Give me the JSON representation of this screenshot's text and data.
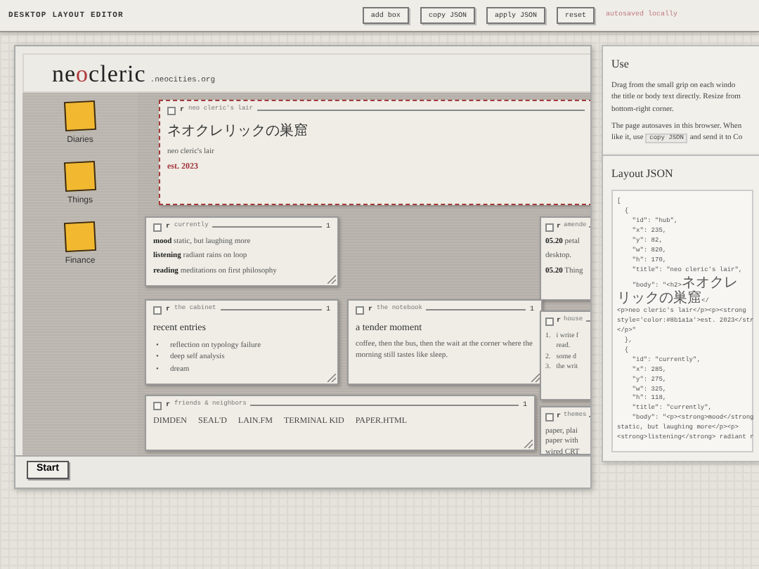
{
  "toolbar": {
    "title": "DESKTOP LAYOUT EDITOR",
    "buttons": [
      "add box",
      "copy JSON",
      "apply JSON",
      "reset"
    ],
    "status": "autosaved locally"
  },
  "site_header": {
    "logo_parts": [
      {
        "text": "ne",
        "accent": false
      },
      {
        "text": "o",
        "accent": true
      },
      {
        "text": "cleric",
        "accent": false
      }
    ],
    "domain": ".neocities.org"
  },
  "desktop_icons": [
    {
      "label": "Diaries"
    },
    {
      "label": "Things"
    },
    {
      "label": "Finance"
    }
  ],
  "windows": [
    {
      "title": "neo cleric's lair",
      "grip": "r",
      "selected": true,
      "checked": false,
      "blocks": [
        {
          "kind": "heading",
          "text": "ネオクレリックの巣窟"
        },
        {
          "kind": "plain",
          "text": "neo cleric's lair"
        },
        {
          "kind": "accent",
          "text": "est. 2023"
        }
      ]
    },
    {
      "title": "currently",
      "grip": "r",
      "end_mark": "1",
      "selected": false,
      "checked": false,
      "blocks": [
        {
          "kind": "field",
          "label": "mood",
          "text": "static, but laughing more"
        },
        {
          "kind": "field",
          "label": "listening",
          "text": "radiant rains on loop"
        },
        {
          "kind": "field",
          "label": "reading",
          "text": "meditations on first philosophy"
        }
      ]
    },
    {
      "title": "amende",
      "grip": "r",
      "selected": false,
      "checked": false,
      "blocks": [
        {
          "kind": "field",
          "label": "05.20",
          "text": "petal"
        },
        {
          "kind": "plain",
          "text": "desktop."
        },
        {
          "kind": "field",
          "label": "05.20",
          "text": "Thing"
        }
      ]
    },
    {
      "title": "the cabinet",
      "grip": "r",
      "end_mark": "1",
      "selected": false,
      "checked": false,
      "blocks": [
        {
          "kind": "heading",
          "text": "recent entries"
        },
        {
          "kind": "bullets",
          "items": [
            {
              "marker": "•",
              "text": "reflection on typology failure"
            },
            {
              "marker": "•",
              "text": "deep self analysis"
            },
            {
              "marker": "•",
              "text": "dream"
            }
          ]
        }
      ]
    },
    {
      "title": "the notebook",
      "grip": "r",
      "end_mark": "1",
      "selected": false,
      "checked": false,
      "blocks": [
        {
          "kind": "heading",
          "text": "a tender moment"
        },
        {
          "kind": "plain",
          "text": "coffee, then the bus, then the wait at the corner where the morning still tastes like sleep."
        }
      ]
    },
    {
      "title": "house",
      "grip": "r",
      "selected": false,
      "checked": false,
      "blocks": [
        {
          "kind": "ordered",
          "items": [
            {
              "marker": "1.",
              "lines": [
                "i write f",
                "read."
              ]
            },
            {
              "marker": "2.",
              "lines": [
                "some d"
              ]
            },
            {
              "marker": "3.",
              "lines": [
                "the writ"
              ]
            }
          ]
        }
      ]
    },
    {
      "title": "friends & neighbors",
      "grip": "r",
      "end_mark": "1",
      "selected": false,
      "checked": false,
      "blocks": [
        {
          "kind": "links",
          "items": [
            "DIMDEN",
            "SEAL'D",
            "LAIN.FM",
            "TERMINAL KID",
            "PAPER.HTML"
          ]
        }
      ]
    },
    {
      "title": "themes",
      "grip": "r",
      "selected": false,
      "checked": false,
      "blocks": [
        {
          "kind": "lines",
          "items": [
            "paper, plai",
            "paper with",
            "wired CRT"
          ]
        }
      ]
    }
  ],
  "taskbar": {
    "start": "Start"
  },
  "use_panel": {
    "title": "Use",
    "paragraphs": [
      [
        [
          {
            "kind": "text",
            "text": "Drag from the small grip on each windo"
          }
        ],
        [
          {
            "kind": "text",
            "text": "the title or body text directly. Resize from"
          }
        ],
        [
          {
            "kind": "text",
            "text": "bottom-right corner."
          }
        ]
      ],
      [
        [
          {
            "kind": "text",
            "text": "The page autosaves in this browser. When"
          }
        ],
        [
          {
            "kind": "text",
            "text": "like it, use "
          },
          {
            "kind": "code",
            "text": "copy JSON"
          },
          {
            "kind": "text",
            "text": " and send it to Co"
          }
        ]
      ]
    ]
  },
  "json_panel": {
    "title": "Layout JSON",
    "lines": [
      "[",
      "  {",
      "    \"id\": \"hub\",",
      "    \"x\": 235,",
      "    \"y\": 82,",
      "    \"w\": 820,",
      "    \"h\": 170,",
      "    \"title\": \"neo cleric's lair\",",
      "    \"body\": \"<h2>ネオクレリックの巣窟</",
      "<p>neo cleric's lair</p><p><strong",
      "style='color:#8b1a1a'>est. 2023</str",
      "</p>\"",
      "  },",
      "  {",
      "    \"id\": \"currently\",",
      "    \"x\": 285,",
      "    \"y\": 275,",
      "    \"w\": 325,",
      "    \"h\": 118,",
      "    \"title\": \"currently\",",
      "    \"body\": \"<p><strong>mood</strong",
      "static, but laughing more</p><p>",
      "<strong>listening</strong> radiant r"
    ]
  }
}
